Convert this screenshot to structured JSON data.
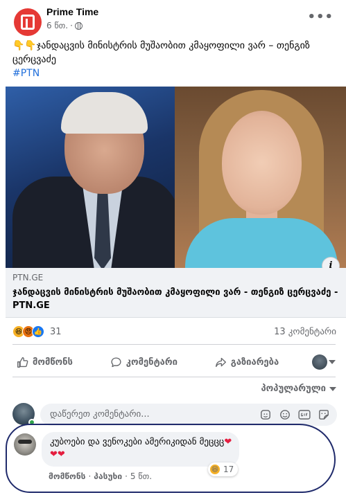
{
  "post": {
    "page_name": "Prime Time",
    "time": "6 წთ.",
    "separator": "·",
    "text_main": "👇👇ჯანდაცვის მინისტრის მუშაობით კმაყოფილი ვარ – თენგიზ ცერცვაძე",
    "hashtag": "#PTN",
    "more_label": "•••"
  },
  "link": {
    "domain": "PTN.GE",
    "title": "ჯანდაცვის მინისტრის მუშაობით კმაყოფილი ვარ - თენგიზ ცერცვაძე - PTN.GE",
    "info_label": "i"
  },
  "stats": {
    "reaction_count": "31",
    "comment_count": "13 კომენტარი"
  },
  "actions": {
    "like": "მომწონს",
    "comment": "კომენტარი",
    "share": "გაზიარება"
  },
  "sort": {
    "label": "პოპულარული"
  },
  "composer": {
    "placeholder": "დაწერეთ კომენტარი..."
  },
  "comment": {
    "text": "კუბოები და ვენოკები ამერიკიდან მეცცც",
    "hearts": "❤❤❤",
    "reaction_count": "17",
    "like_label": "მომწონს",
    "reply_label": "პასუხი",
    "time": "5 წთ."
  },
  "icons": {
    "page-logo": "prime-time-logo",
    "globe": "globe-icon",
    "like": "thumbs-up-icon",
    "comment": "speech-bubble-icon",
    "share": "share-arrow-icon"
  },
  "colors": {
    "link_blue": "#216fdb",
    "like_blue": "#1877f2",
    "heart_red": "#e41e3f",
    "logo_red": "#e53935",
    "highlight_stroke": "#1f2a6b"
  }
}
